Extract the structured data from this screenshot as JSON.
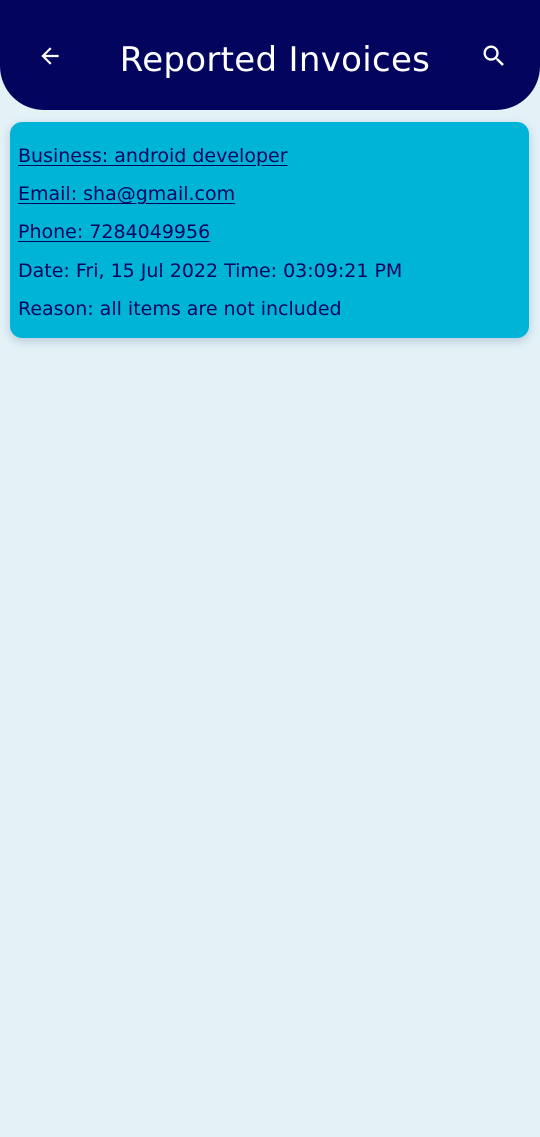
{
  "header": {
    "title": "Reported Invoices",
    "back_icon": "arrow-left-icon",
    "search_icon": "search-icon",
    "background_color": "#03045e"
  },
  "invoices": [
    {
      "business": "Business: android developer",
      "email": "Email: sha@gmail.com",
      "phone": "Phone: 7284049956",
      "datetime": "Date: Fri, 15 Jul 2022 Time:  03:09:21 PM",
      "reason": "Reason: all items are not included",
      "card_color": "#00b4d8",
      "text_color": "#03045e"
    }
  ],
  "page": {
    "background_color": "#e4f2f8"
  }
}
